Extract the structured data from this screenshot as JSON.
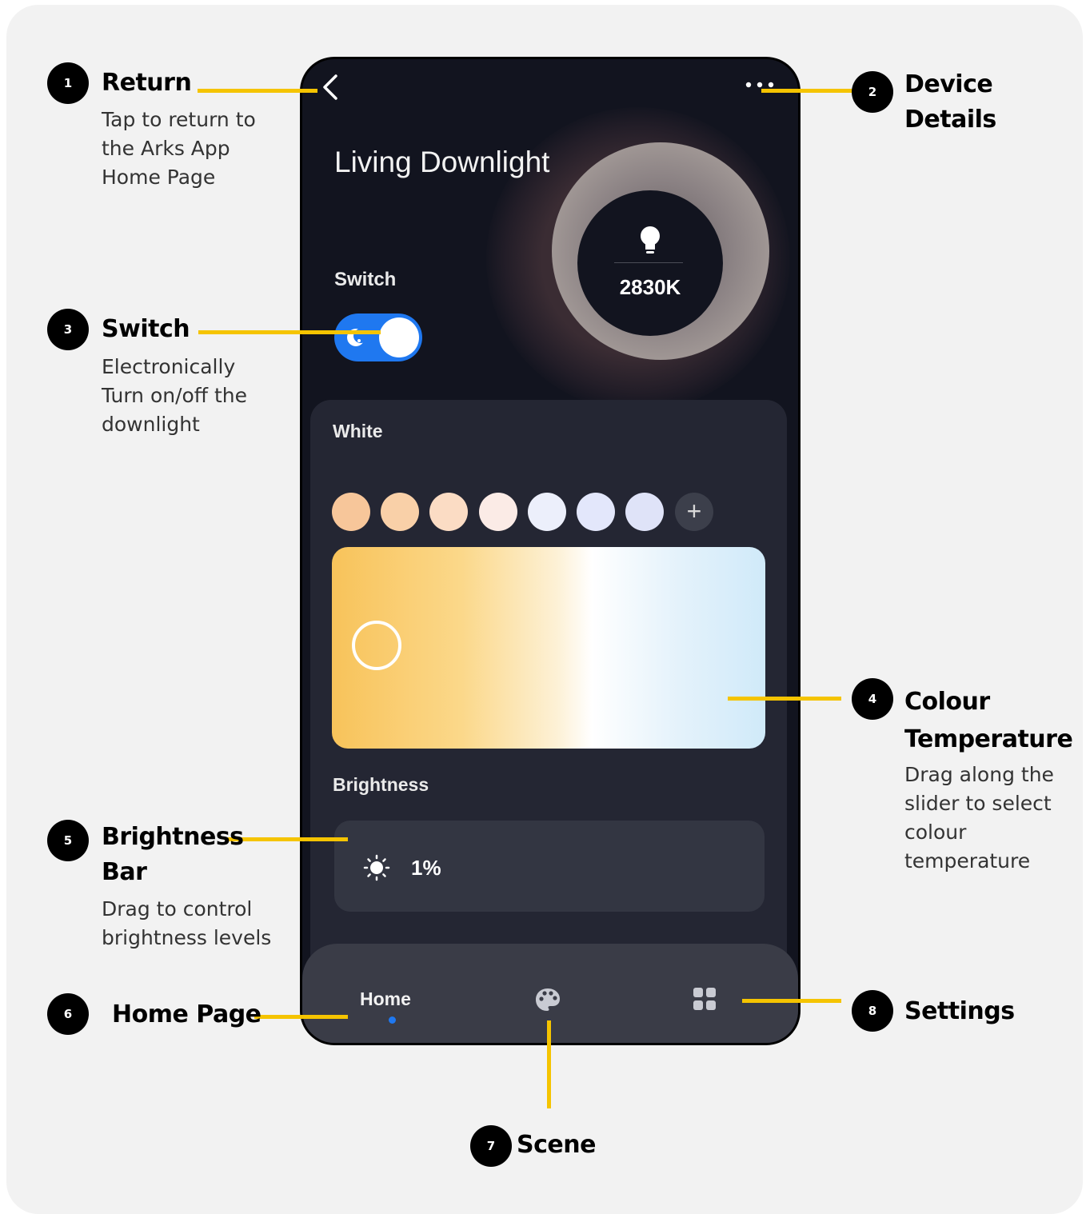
{
  "phone": {
    "device_title": "Living Downlight",
    "temperature_value": "2830K",
    "switch_label": "Switch",
    "switch_on": true,
    "white_label": "White",
    "swatches": [
      "#f7c69a",
      "#f9d0a8",
      "#fbdcc4",
      "#fbebe6",
      "#eceffb",
      "#e3e7fb",
      "#dfe3f8"
    ],
    "brightness_label": "Brightness",
    "brightness_value": "1%",
    "nav": {
      "home_label": "Home"
    },
    "accent_color": "#1f78f0"
  },
  "callouts": [
    {
      "num": "1",
      "title": "Return",
      "desc": [
        "Tap to return to",
        "the Arks App",
        "Home Page"
      ]
    },
    {
      "num": "2",
      "title": [
        "Device",
        "Details"
      ]
    },
    {
      "num": "3",
      "title": "Switch",
      "desc": [
        "Electronically",
        "Turn on/off the",
        "downlight"
      ]
    },
    {
      "num": "4",
      "title": [
        "Colour",
        "Temperature"
      ],
      "desc": [
        "Drag along the",
        "slider to select",
        "colour",
        "temperature"
      ]
    },
    {
      "num": "5",
      "title": [
        "Brightness",
        "Bar"
      ],
      "desc": [
        "Drag to control",
        "brightness levels"
      ]
    },
    {
      "num": "6",
      "title": "Home Page"
    },
    {
      "num": "7",
      "title": "Scene"
    },
    {
      "num": "8",
      "title": "Settings"
    }
  ],
  "icons": [
    "back-chevron-icon",
    "more-dots-icon",
    "lightbulb-icon",
    "moon-icon",
    "plus-icon",
    "sun-icon",
    "palette-icon",
    "grid-icon"
  ],
  "callout_line_color": "#f5c400"
}
